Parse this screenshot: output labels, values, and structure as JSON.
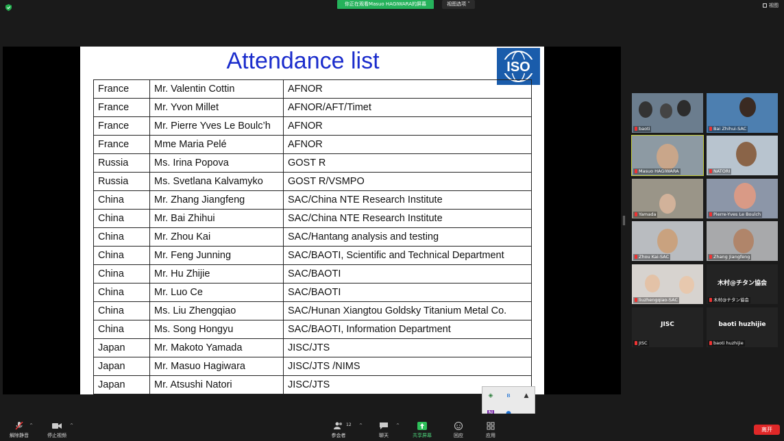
{
  "topbar": {
    "viewing_banner": "你正在观看Masuo  HAGIWARA的屏幕",
    "view_options": "视图选项 ˅",
    "view_button": "视图"
  },
  "slide": {
    "title": "Attendance list",
    "logo_text": "ISO",
    "rows": [
      [
        "France",
        "Mr. Valentin Cottin",
        "AFNOR"
      ],
      [
        "France",
        "Mr. Yvon Millet",
        "AFNOR/AFT/Timet"
      ],
      [
        "France",
        "Mr. Pierre Yves Le Boulc’h",
        "AFNOR"
      ],
      [
        "France",
        "Mme Maria Pelé",
        "AFNOR"
      ],
      [
        "Russia",
        "Ms. Irina Popova",
        "GOST R"
      ],
      [
        "Russia",
        "Ms. Svetlana Kalvamyko",
        "GOST R/VSMPO"
      ],
      [
        "China",
        "Mr. Zhang Jiangfeng",
        "SAC/China NTE Research Institute"
      ],
      [
        "China",
        "Mr. Bai Zhihui",
        "SAC/China NTE Research Institute"
      ],
      [
        "China",
        "Mr. Zhou Kai",
        "SAC/Hantang analysis and testing"
      ],
      [
        "China",
        "Mr. Feng Junning",
        "SAC/BAOTI, Scientific and Technical Department"
      ],
      [
        "China",
        "Mr. Hu Zhijie",
        "SAC/BAOTI"
      ],
      [
        "China",
        "Mr. Luo Ce",
        "SAC/BAOTI"
      ],
      [
        "China",
        "Ms. Liu Zhengqiao",
        "SAC/Hunan Xiangtou Goldsky Titanium Metal Co."
      ],
      [
        "China",
        "Ms. Song Hongyu",
        "SAC/BAOTI, Information Department"
      ],
      [
        "Japan",
        "Mr. Makoto Yamada",
        "JISC/JTS"
      ],
      [
        "Japan",
        "Mr. Masuo Hagiwara",
        "JISC/JTS /NIMS"
      ],
      [
        "Japan",
        "Mr. Atsushi Natori",
        "JISC/JTS"
      ]
    ]
  },
  "participants": [
    {
      "name": "baoti"
    },
    {
      "name": "Bai Zhihui-SAC"
    },
    {
      "name": "Masuo HAGIWARA"
    },
    {
      "name": "NATORI"
    },
    {
      "name": "Yamada"
    },
    {
      "name": "Pierre-Yves Le Boulch"
    },
    {
      "name": "Zhou Kai-SAC"
    },
    {
      "name": "Zhang Jiangfeng"
    },
    {
      "name": "liuzhengqiao-SAC"
    },
    {
      "name": "木村@チタン協会",
      "display": "木村@チタン協会"
    },
    {
      "name": "JISC",
      "display": "JISC"
    },
    {
      "name": "baoti huzhijie",
      "display": "baoti huzhijie"
    }
  ],
  "toolbar": {
    "unmute": "解除静音",
    "stop_video": "停止视频",
    "participants": "参会者",
    "participant_count": "12",
    "chat": "聊天",
    "share_screen": "共享屏幕",
    "reactions": "回应",
    "apps": "应用",
    "leave": "离开"
  },
  "colors": {
    "banner_green": "#25b25b",
    "title_blue": "#1a2ccc",
    "iso_blue": "#1a5cab",
    "active_speaker": "#c6cd3a",
    "leave_red": "#e02828"
  }
}
